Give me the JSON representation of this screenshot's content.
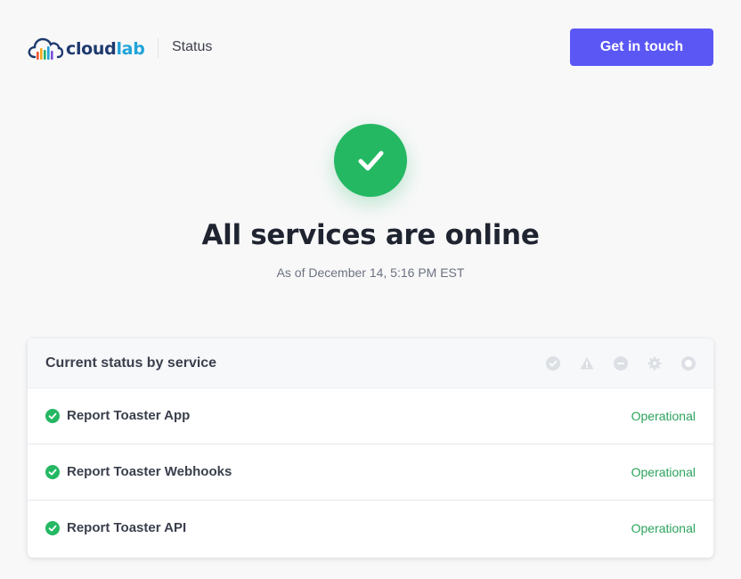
{
  "header": {
    "logo_part1": "cloud",
    "logo_part2": "lab",
    "section_label": "Status",
    "cta_label": "Get in touch"
  },
  "hero": {
    "icon": "check-icon",
    "title": "All services are online",
    "subtitle": "As of December 14, 5:16 PM EST"
  },
  "status_card": {
    "title": "Current status by service",
    "legend_icons": [
      "operational-icon",
      "warning-icon",
      "outage-icon",
      "maintenance-icon",
      "unknown-icon"
    ],
    "services": [
      {
        "name": "Report Toaster App",
        "status": "Operational"
      },
      {
        "name": "Report Toaster Webhooks",
        "status": "Operational"
      },
      {
        "name": "Report Toaster API",
        "status": "Operational"
      }
    ]
  },
  "colors": {
    "accent": "#5b57f5",
    "success": "#24b863",
    "success_text": "#2aa35c",
    "brand_dark": "#1e3a6e",
    "brand_light": "#21a4d8"
  }
}
